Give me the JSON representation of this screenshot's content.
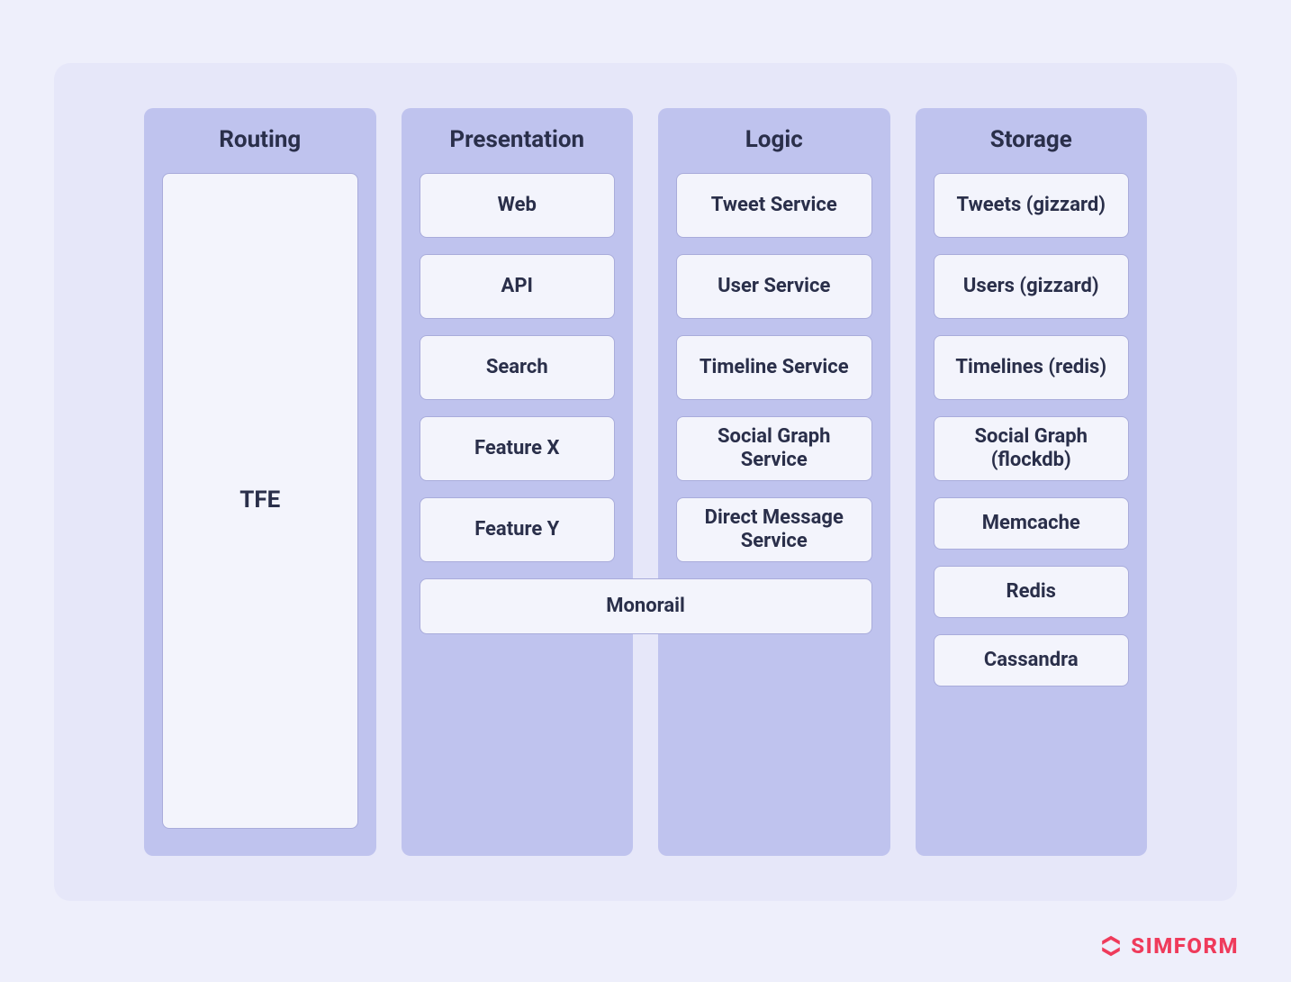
{
  "columns": [
    {
      "title": "Routing",
      "items": [
        "TFE"
      ],
      "layout": "single"
    },
    {
      "title": "Presentation",
      "items": [
        "Web",
        "API",
        "Search",
        "Feature X",
        "Feature Y"
      ],
      "layout": "stack"
    },
    {
      "title": "Logic",
      "items": [
        "Tweet Service",
        "User Service",
        "Timeline Service",
        "Social Graph Service",
        "Direct Message Service"
      ],
      "layout": "stack"
    },
    {
      "title": "Storage",
      "items": [
        "Tweets (gizzard)",
        "Users (gizzard)",
        "Timelines (redis)",
        "Social Graph (flockdb)",
        "Memcache",
        "Redis",
        "Cassandra"
      ],
      "layout": "stack"
    }
  ],
  "spanning": {
    "label": "Monorail",
    "fromCol": 1,
    "toCol": 2
  },
  "brand": {
    "name": "SIMFORM"
  },
  "colors": {
    "page": "#EEEFFB",
    "panel": "#E6E7F9",
    "column": "#BFC3EE",
    "cellBg": "#F3F4FC",
    "cellBorder": "#A9ACDB",
    "text": "#2A2F4A",
    "brand": "#EF3B5B"
  }
}
